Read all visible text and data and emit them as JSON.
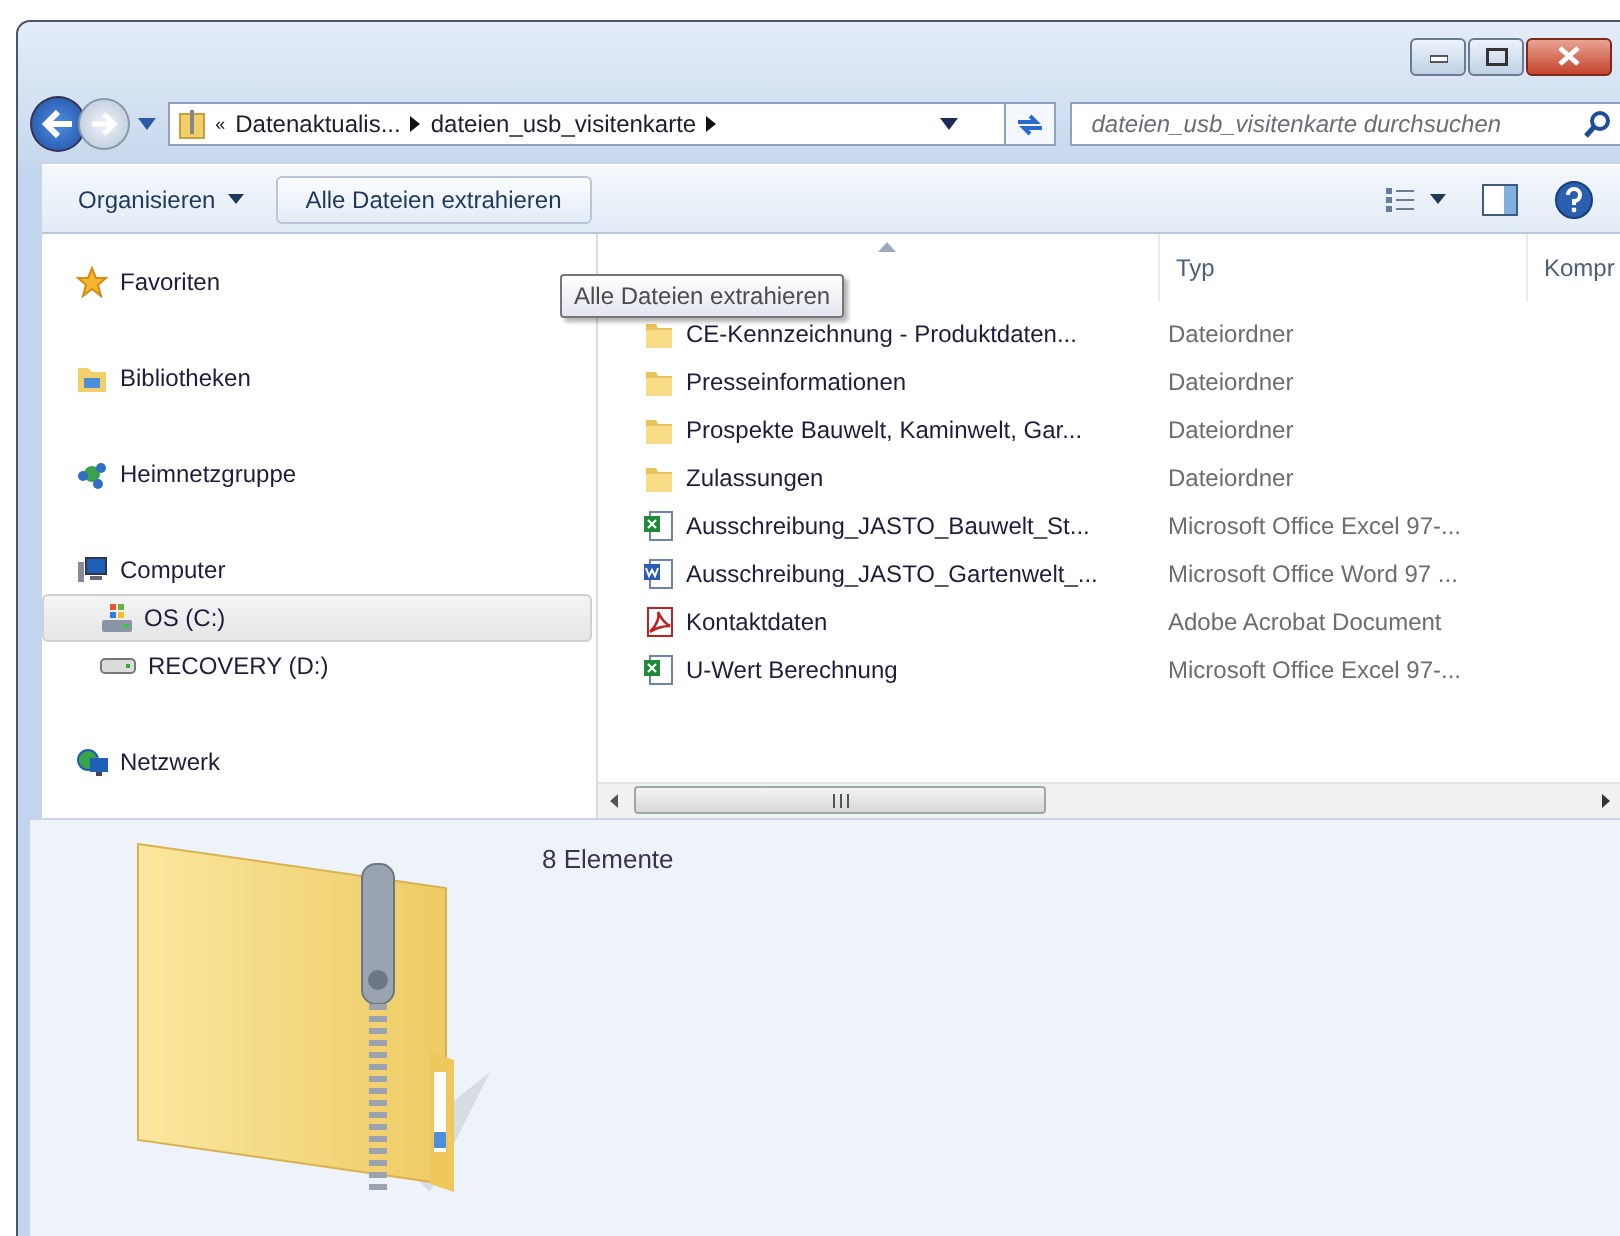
{
  "window": {
    "caption_buttons": [
      {
        "kind": "minimize"
      },
      {
        "kind": "maximize"
      },
      {
        "kind": "close"
      }
    ]
  },
  "address_bar": {
    "prefix": "«",
    "crumbs": [
      "Datenaktualis...",
      "dateien_usb_visitenkarte"
    ]
  },
  "search": {
    "placeholder": "dateien_usb_visitenkarte durchsuchen"
  },
  "toolbar": {
    "items": [
      {
        "label": "Organisieren",
        "kind": "menu"
      },
      {
        "label": "Alle Dateien extrahieren",
        "kind": "button"
      }
    ]
  },
  "navigation": [
    {
      "label": "Favoriten",
      "kind": "star",
      "selected": false
    },
    {
      "label": "Bibliotheken",
      "kind": "library",
      "selected": false
    },
    {
      "label": "Heimnetzgruppe",
      "kind": "homegroup",
      "selected": false
    },
    {
      "label": "Computer",
      "kind": "computer",
      "selected": false,
      "children": [
        {
          "label": "OS (C:)",
          "kind": "osdrive",
          "selected": true
        },
        {
          "label": "RECOVERY (D:)",
          "kind": "drive",
          "selected": false
        }
      ]
    },
    {
      "label": "Netzwerk",
      "kind": "network",
      "selected": false
    }
  ],
  "file_list": {
    "columns": [
      {
        "label": "Typ"
      },
      {
        "label": "Kompr"
      }
    ],
    "rows": [
      {
        "name": "CE-Kennzeichnung - Produktdaten...",
        "type": "Dateiordner",
        "kind": "folder"
      },
      {
        "name": "Presseinformationen",
        "type": "Dateiordner",
        "kind": "folder"
      },
      {
        "name": "Prospekte Bauwelt, Kaminwelt, Gar...",
        "type": "Dateiordner",
        "kind": "folder"
      },
      {
        "name": "Zulassungen",
        "type": "Dateiordner",
        "kind": "folder"
      },
      {
        "name": "Ausschreibung_JASTO_Bauwelt_St...",
        "type": "Microsoft Office Excel 97-...",
        "kind": "excel"
      },
      {
        "name": "Ausschreibung_JASTO_Gartenwelt_...",
        "type": "Microsoft Office Word 97 ...",
        "kind": "word"
      },
      {
        "name": "Kontaktdaten",
        "type": "Adobe Acrobat Document",
        "kind": "pdf"
      },
      {
        "name": "U-Wert Berechnung",
        "type": "Microsoft Office Excel 97-...",
        "kind": "excel"
      }
    ]
  },
  "tooltip": "Alle Dateien extrahieren",
  "details": {
    "count": "8 Elemente"
  }
}
